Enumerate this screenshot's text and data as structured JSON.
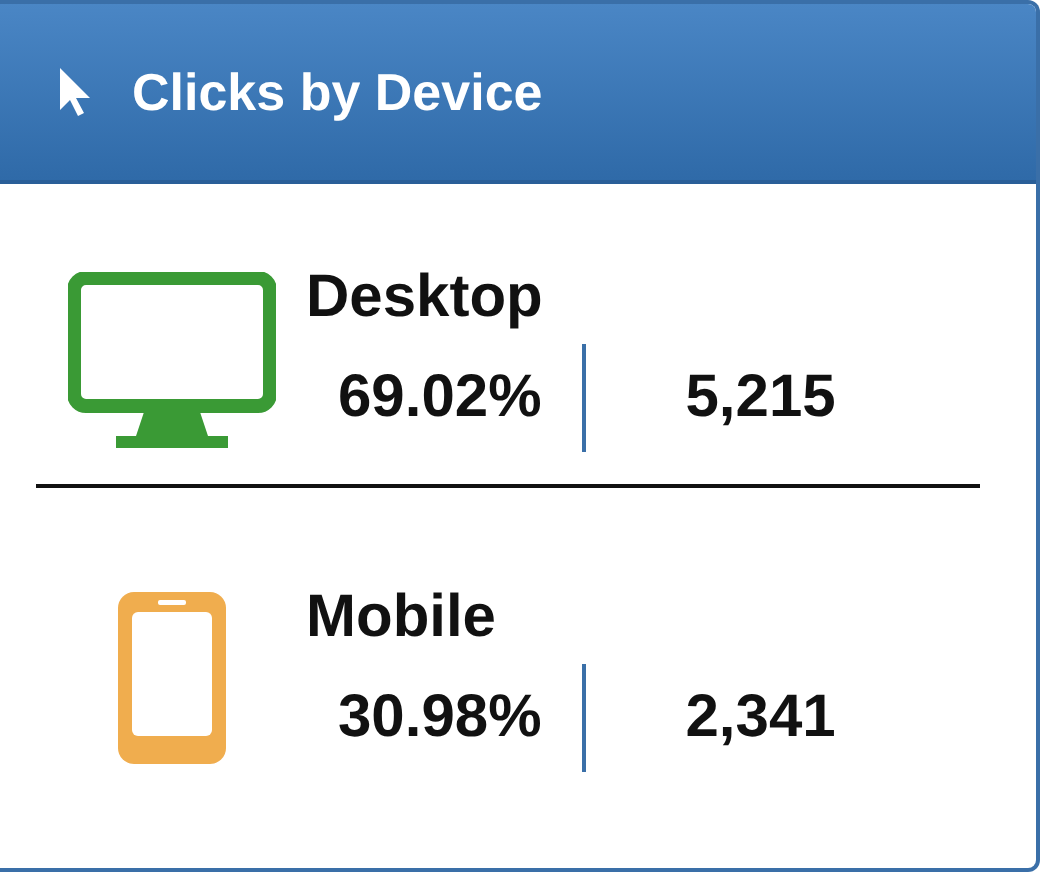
{
  "title": "Clicks by Device",
  "devices": [
    {
      "kind": "desktop",
      "name": "Desktop",
      "percent": "69.02%",
      "count": "5,215",
      "color": "#3a9a35"
    },
    {
      "kind": "mobile",
      "name": "Mobile",
      "percent": "30.98%",
      "count": "2,341",
      "color": "#f0ad4e"
    }
  ]
}
